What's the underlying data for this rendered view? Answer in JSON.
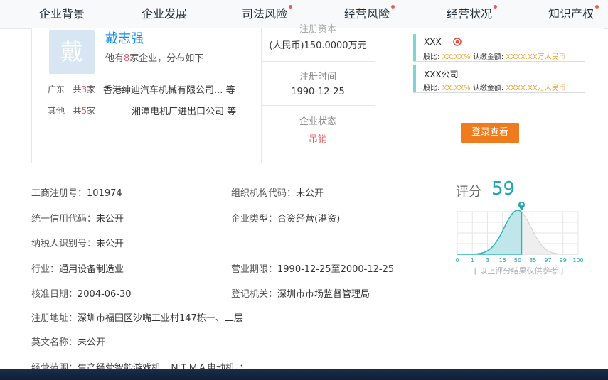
{
  "nav": {
    "items": [
      {
        "label": "企业背景",
        "dot": false
      },
      {
        "label": "企业发展",
        "dot": false
      },
      {
        "label": "司法风险",
        "dot": true
      },
      {
        "label": "经营风险",
        "dot": true
      },
      {
        "label": "经营状况",
        "dot": true
      },
      {
        "label": "知识产权",
        "dot": true
      }
    ]
  },
  "legal_rep": {
    "avatar_char": "戴",
    "name": "戴志强",
    "summary_prefix": "他有",
    "summary_count": "8",
    "summary_suffix": "家企业，分布如下",
    "regions": [
      {
        "region": "广东",
        "count_prefix": "共",
        "count": "3",
        "count_suffix": "家",
        "company": "香港绅迪汽车机械有限公司... 等"
      },
      {
        "region": "其他",
        "count_prefix": "共",
        "count": "5",
        "count_suffix": "家",
        "company": "湘潭电机厂进出口公司 等"
      }
    ]
  },
  "capital": {
    "label": "注册资本",
    "value": "(人民币)150.0000万元"
  },
  "reg_time": {
    "label": "注册时间",
    "value": "1990-12-25"
  },
  "status": {
    "label": "企业状态",
    "value": "吊销",
    "color": "#e95b5b"
  },
  "shareholders": [
    {
      "name": "XXX",
      "ratio_label": "股比:",
      "ratio": "XX.XX%",
      "amount_label": "认缴金额:",
      "amount": "XXXX.XX万人民币",
      "has_badge": true
    },
    {
      "name": "XXX公司",
      "ratio_label": "股比:",
      "ratio": "XX.XX%",
      "amount_label": "认缴金额:",
      "amount": "XXXX.XX万人民币",
      "has_badge": false
    }
  ],
  "login_button": "登录查看",
  "fields": {
    "reg_no": {
      "label": "工商注册号：",
      "value": "101974"
    },
    "org_code": {
      "label": "组织机构代码：",
      "value": "未公开"
    },
    "credit_code": {
      "label": "统一信用代码：",
      "value": "未公开"
    },
    "company_type": {
      "label": "企业类型：",
      "value": "合资经营(港资)"
    },
    "taxpayer_id": {
      "label": "纳税人识别号：",
      "value": "未公开"
    },
    "industry": {
      "label": "行业：",
      "value": "通用设备制造业"
    },
    "term": {
      "label": "营业期限：",
      "value": "1990-12-25至2000-12-25"
    },
    "approve_date": {
      "label": "核准日期：",
      "value": "2004-06-30"
    },
    "authority": {
      "label": "登记机关：",
      "value": "深圳市市场监督管理局"
    },
    "address": {
      "label": "注册地址：",
      "value": "深圳市福田区沙嘴工业村147栋一、二层"
    },
    "english_name": {
      "label": "英文名称：",
      "value": "未公开"
    },
    "scope": {
      "label": "经营范围：",
      "value": "生产经营智能游戏机、ＮＩＭＡ电动机。；"
    }
  },
  "score": {
    "label": "评分",
    "value": "59",
    "note": "[ 以上评分结果仅供参考 ]",
    "axis_ticks": [
      "0",
      "1",
      "3",
      "15",
      "50",
      "85",
      "97",
      "99",
      "100"
    ],
    "accent": "#1fa7b0"
  },
  "chart_data": {
    "type": "area",
    "xlabel": "",
    "ylabel": "",
    "x_ticks": [
      "0",
      "1",
      "3",
      "15",
      "50",
      "85",
      "97",
      "99",
      "100"
    ],
    "marker_value": 59,
    "note": "bell-shaped score distribution; highlighted region up to score"
  }
}
